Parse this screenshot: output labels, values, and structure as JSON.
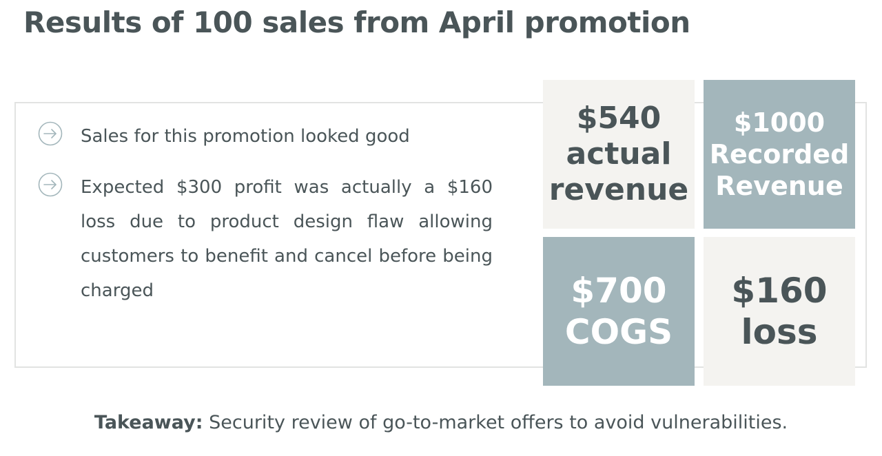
{
  "title": "Results of 100 sales from April promotion",
  "bullets": [
    {
      "icon": "arrow-right-circle-icon",
      "text": "Sales for this promotion looked good"
    },
    {
      "icon": "arrow-right-circle-icon",
      "text": "Expected $300 profit was actually a $160 loss due to product design flaw allowing customers to benefit and cancel before being charged"
    }
  ],
  "tiles": {
    "actual_revenue": {
      "value": "$540",
      "label_line1": "actual",
      "label_line2": "revenue"
    },
    "recorded_revenue": {
      "value": "$1000",
      "label_line1": "Recorded",
      "label_line2": "Revenue"
    },
    "cogs": {
      "value": "$700",
      "label": "COGS"
    },
    "loss": {
      "value": "$160",
      "label": "loss"
    }
  },
  "takeaway": {
    "label": "Takeaway:",
    "text": " Security review of go-to-market offers to avoid vulnerabilities."
  },
  "colors": {
    "text": "#4a5558",
    "tile_light": "#f4f3f0",
    "tile_dark": "#a3b6bb",
    "border": "#e2e3e2",
    "icon": "#a3b6bb"
  }
}
